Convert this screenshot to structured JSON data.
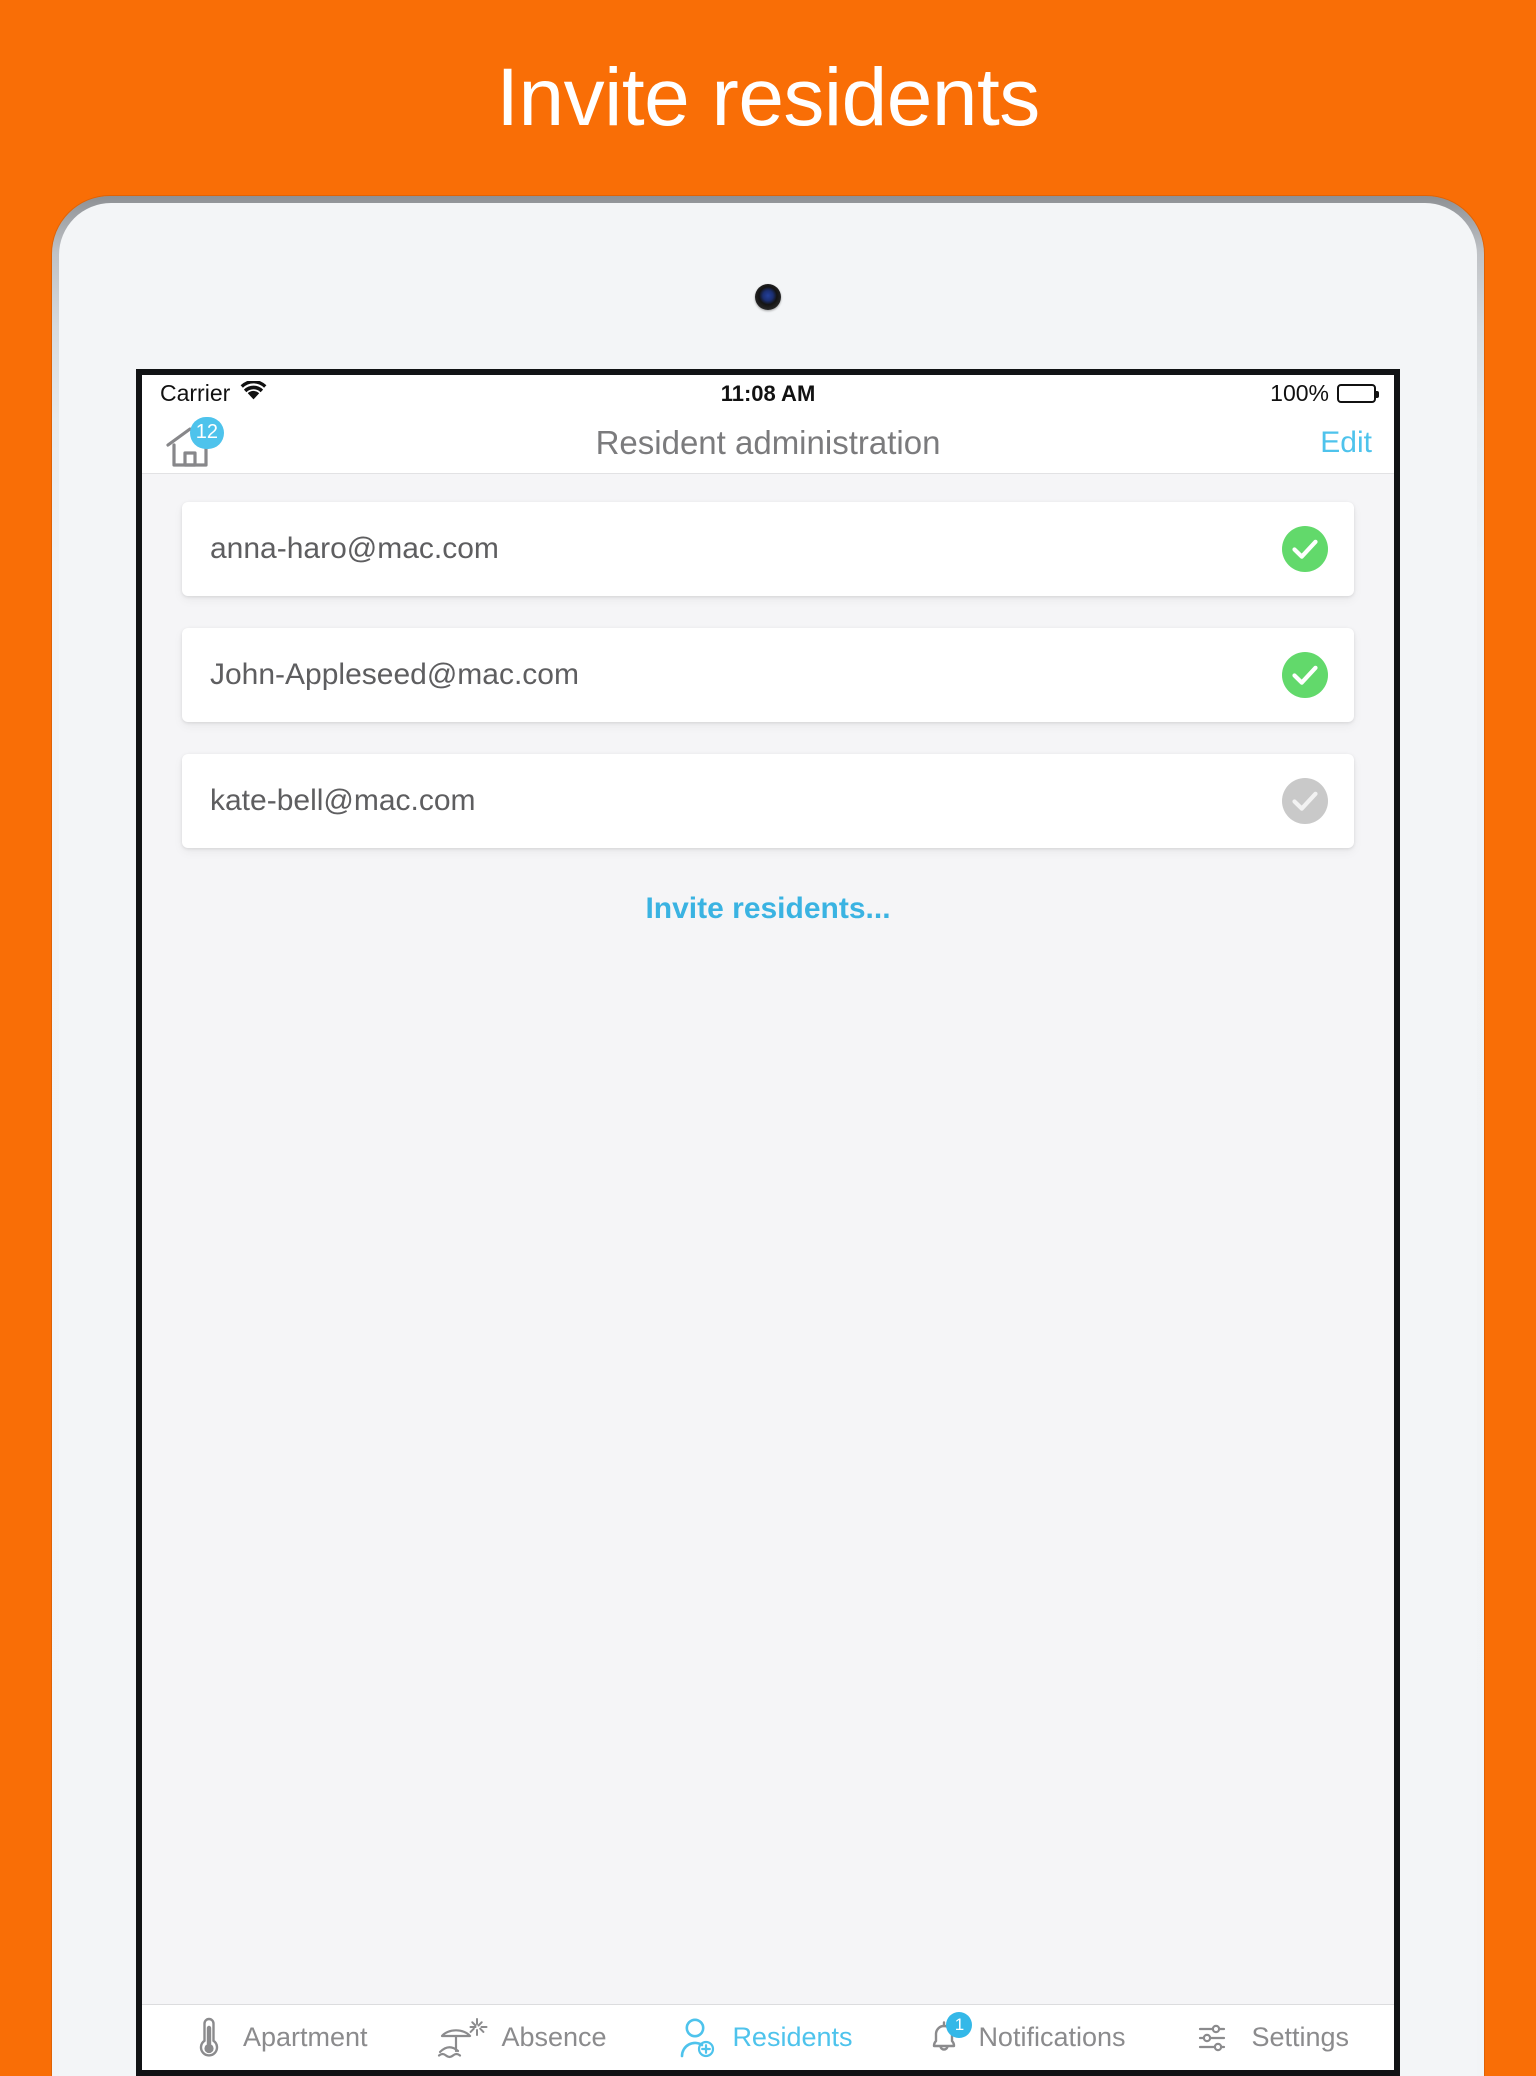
{
  "promo": {
    "title": "Invite residents",
    "background_color": "#F96E06",
    "text_color": "#FFFFFF"
  },
  "status_bar": {
    "carrier": "Carrier",
    "wifi_icon": "wifi-icon",
    "time": "11:08 AM",
    "battery_percent": "100%",
    "battery_icon": "battery-full-icon"
  },
  "nav_bar": {
    "home_icon": "home-icon",
    "home_badge": "12",
    "title": "Resident administration",
    "edit_label": "Edit",
    "accent_color": "#4EC3EC",
    "title_color": "#7B7B7D"
  },
  "main": {
    "residents": [
      {
        "email": "anna-haro@mac.com",
        "status": "accepted",
        "status_icon": "check-circle-icon",
        "status_color": "#62D96B"
      },
      {
        "email": "John-Appleseed@mac.com",
        "status": "accepted",
        "status_icon": "check-circle-icon",
        "status_color": "#62D96B"
      },
      {
        "email": "kate-bell@mac.com",
        "status": "pending",
        "status_icon": "check-circle-icon",
        "status_color": "#C9C9C9"
      }
    ],
    "invite_link_label": "Invite residents...",
    "invite_link_color": "#3AB3E2"
  },
  "tab_bar": {
    "items": [
      {
        "label": "Apartment",
        "icon": "thermometer-icon",
        "active": false,
        "badge": ""
      },
      {
        "label": "Absence",
        "icon": "beach-umbrella-icon",
        "active": false,
        "badge": ""
      },
      {
        "label": "Residents",
        "icon": "add-person-icon",
        "active": true,
        "badge": ""
      },
      {
        "label": "Notifications",
        "icon": "bell-icon",
        "active": false,
        "badge": "1"
      },
      {
        "label": "Settings",
        "icon": "sliders-icon",
        "active": false,
        "badge": ""
      }
    ],
    "active_color": "#4EC3EC",
    "inactive_color": "#8B8B8D"
  }
}
